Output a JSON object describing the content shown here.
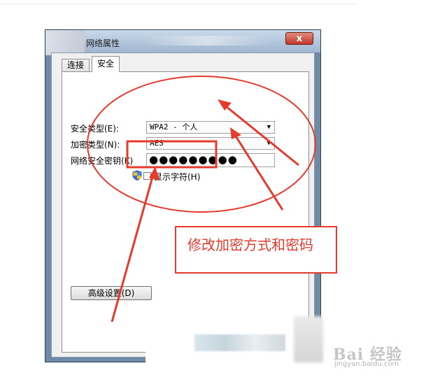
{
  "window": {
    "title": "网络属性",
    "close_glyph": "x"
  },
  "tabs": [
    {
      "label": "连接"
    },
    {
      "label": "安全"
    }
  ],
  "form": {
    "security_type_label": "安全类型(E):",
    "security_type_value": "WPA2 - 个人",
    "encryption_type_label": "加密类型(N):",
    "encryption_type_value": "AES",
    "key_label": "网络安全密钥(K)",
    "key_value": "●●●●●●●●●",
    "show_chars_label": "显示字符(H)",
    "show_chars_checked": false,
    "advanced_button": "高级设置(D)"
  },
  "annotation": {
    "text": "修改加密方式和密码",
    "color": "#e53a2e"
  },
  "watermark": {
    "main": "Bai 经验",
    "sub": "jingyan.baidu.com"
  },
  "icons": {
    "shield": "uac-shield-icon",
    "dropdown": "chevron-down-icon"
  }
}
